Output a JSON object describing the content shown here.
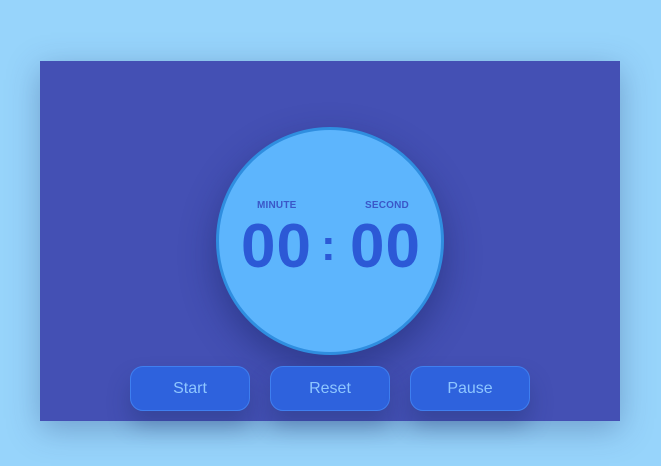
{
  "timer": {
    "minute_label": "MINUTE",
    "second_label": "SECOND",
    "minutes": "00",
    "separator": ":",
    "seconds": "00"
  },
  "controls": {
    "start_label": "Start",
    "reset_label": "Reset",
    "pause_label": "Pause"
  },
  "colors": {
    "page_background": "#97d4fb",
    "panel_background": "#4450b4",
    "dial_fill": "#5db5fd",
    "digit_color": "#2c59d6",
    "button_fill": "#2e62dd",
    "button_text": "#8ec6ff"
  }
}
